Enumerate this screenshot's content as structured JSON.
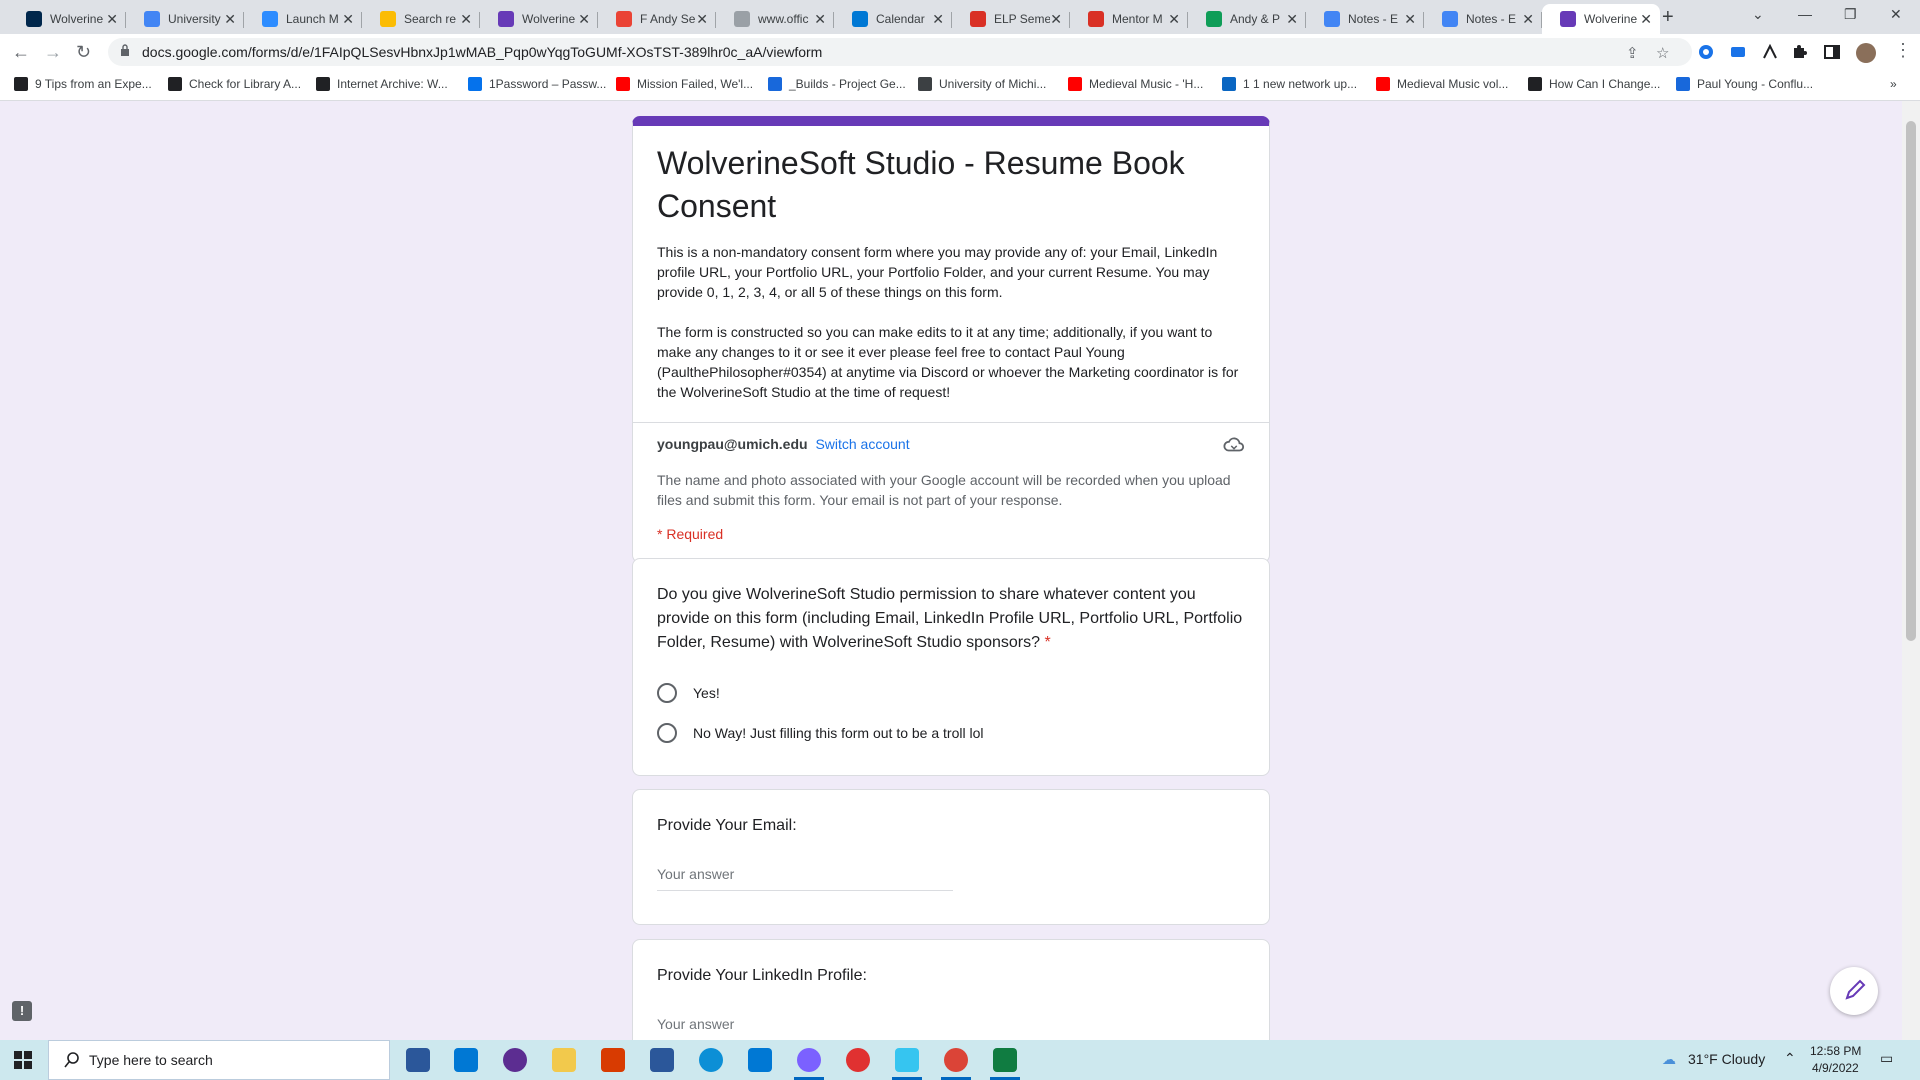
{
  "tabs": [
    {
      "title": "Wolverine",
      "icon": "michigan-icon",
      "color": "#00274c"
    },
    {
      "title": "University",
      "icon": "calendar-9-icon",
      "color": "#4285f4"
    },
    {
      "title": "Launch M",
      "icon": "zoom-icon",
      "color": "#2d8cff"
    },
    {
      "title": "Search re",
      "icon": "drive-icon",
      "color": "#fbbc04"
    },
    {
      "title": "Wolverine",
      "icon": "forms-icon",
      "color": "#673ab7"
    },
    {
      "title": "F Andy Se",
      "icon": "gmail-icon",
      "color": "#ea4335"
    },
    {
      "title": "www.offic",
      "icon": "page-icon",
      "color": "#9aa0a6"
    },
    {
      "title": "Calendar",
      "icon": "outlook-calendar-icon",
      "color": "#0078d4"
    },
    {
      "title": "ELP Seme",
      "icon": "loading-icon",
      "color": "#d93025"
    },
    {
      "title": "Mentor M",
      "icon": "loading-icon",
      "color": "#d93025"
    },
    {
      "title": "Andy & P",
      "icon": "sheets-icon",
      "color": "#0f9d58"
    },
    {
      "title": "Notes - E",
      "icon": "docs-icon",
      "color": "#4285f4"
    },
    {
      "title": "Notes - E",
      "icon": "docs-icon",
      "color": "#4285f4"
    },
    {
      "title": "Wolverine",
      "icon": "forms-icon",
      "color": "#673ab7"
    }
  ],
  "browser": {
    "url": "docs.google.com/forms/d/e/1FAIpQLSesvHbnxJp1wMAB_Pqp0wYqgToGUMf-XOsTST-389lhr0c_aA/viewform"
  },
  "bookmarks": [
    {
      "label": "9 Tips from an Expe...",
      "icon": "globe-icon",
      "color": "#202124"
    },
    {
      "label": "Check for Library A...",
      "icon": "globe-icon",
      "color": "#202124"
    },
    {
      "label": "Internet Archive: W...",
      "icon": "archive-icon",
      "color": "#202124"
    },
    {
      "label": "1Password – Passw...",
      "icon": "1password-icon",
      "color": "#0572ec"
    },
    {
      "label": "Mission Failed, We'l...",
      "icon": "youtube-icon",
      "color": "#ff0000"
    },
    {
      "label": "_Builds - Project Ge...",
      "icon": "confluence-icon",
      "color": "#1868db"
    },
    {
      "label": "University of Michi...",
      "icon": "cube-icon",
      "color": "#3c4043"
    },
    {
      "label": "Medieval Music - 'H...",
      "icon": "youtube-icon",
      "color": "#ff0000"
    },
    {
      "label": "1 1 new network up...",
      "icon": "linkedin-icon",
      "color": "#0a66c2"
    },
    {
      "label": "Medieval Music vol...",
      "icon": "youtube-icon",
      "color": "#ff0000"
    },
    {
      "label": "How Can I Change...",
      "icon": "wikipedia-icon",
      "color": "#202124"
    },
    {
      "label": "Paul Young - Conflu...",
      "icon": "confluence-icon",
      "color": "#1868db"
    }
  ],
  "form": {
    "title": "WolverineSoft Studio - Resume Book Consent",
    "desc1": "This is a non-mandatory consent form where you may provide any of: your Email, LinkedIn profile URL, your Portfolio URL, your Portfolio Folder, and your current Resume. You may provide 0, 1, 2, 3, 4, or all 5 of these things on this form.",
    "desc2": "The form is constructed so you can make edits to it at any time; additionally, if you want to make any changes to it or see it ever please feel free to contact Paul Young (PaulthePhilosopher#0354) at anytime via Discord or whoever the Marketing coordinator is for the WolverineSoft Studio at the time of request!",
    "account_email": "youngpau@umich.edu",
    "switch_account": "Switch account",
    "account_note": "The name and photo associated with your Google account will be recorded when you upload files and submit this form. Your email is not part of your response.",
    "required_note": "* Required",
    "q1": {
      "text": "Do you give WolverineSoft Studio permission to share whatever content you provide on this form (including Email, LinkedIn Profile URL, Portfolio URL, Portfolio Folder, Resume) with WolverineSoft Studio sponsors?",
      "star": "*",
      "options": [
        "Yes!",
        "No Way! Just filling this form out to be a troll lol"
      ]
    },
    "q2": {
      "text": "Provide Your Email:",
      "placeholder": "Your answer"
    },
    "q3": {
      "text": "Provide Your LinkedIn Profile:",
      "placeholder": "Your answer"
    }
  },
  "taskbar": {
    "search_placeholder": "Type here to search",
    "weather": "31°F  Cloudy",
    "time": "12:58 PM",
    "date": "4/9/2022"
  },
  "colors": {
    "accent": "#673ab7",
    "link": "#1a73e8",
    "required": "#d93025"
  }
}
